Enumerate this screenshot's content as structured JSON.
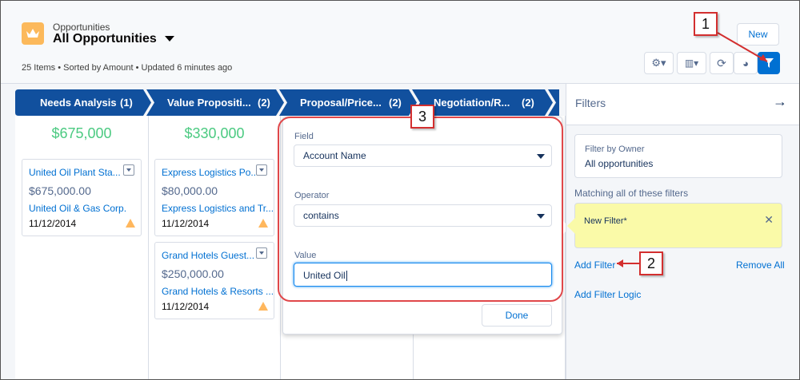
{
  "header": {
    "object_label": "Opportunities",
    "list_view": "All Opportunities",
    "meta": "25 Items • Sorted by Amount • Updated 6 minutes ago",
    "new_label": "New"
  },
  "stages": [
    {
      "name": "Needs Analysis",
      "count": "(1)"
    },
    {
      "name": "Value Propositi...",
      "count": "(2)"
    },
    {
      "name": "Proposal/Price...",
      "count": "(2)"
    },
    {
      "name": "Negotiation/R...",
      "count": "(2)"
    }
  ],
  "columns": [
    {
      "total": "$675,000",
      "cards": [
        {
          "name": "United Oil Plant Sta...",
          "amount": "$675,000.00",
          "account": "United Oil & Gas Corp.",
          "date": "11/12/2014"
        }
      ]
    },
    {
      "total": "$330,000",
      "cards": [
        {
          "name": "Express Logistics Po...",
          "amount": "$80,000.00",
          "account": "Express Logistics and Tr...",
          "date": "11/12/2014"
        },
        {
          "name": "Grand Hotels Guest...",
          "amount": "$250,000.00",
          "account": "Grand Hotels & Resorts ...",
          "date": "11/12/2014"
        }
      ]
    }
  ],
  "popover": {
    "field_label": "Field",
    "field_value": "Account Name",
    "operator_label": "Operator",
    "operator_value": "contains",
    "value_label": "Value",
    "value_value": "United Oil",
    "done_label": "Done"
  },
  "panel": {
    "title": "Filters",
    "owner_label": "Filter by Owner",
    "owner_value": "All opportunities",
    "matching": "Matching all of these filters",
    "new_filter": "New Filter*",
    "add_filter": "Add Filter",
    "remove_all": "Remove All",
    "add_logic": "Add Filter Logic"
  },
  "callouts": [
    "1",
    "2",
    "3"
  ],
  "colors": {
    "stage": "#11509e",
    "accent": "#0070d2",
    "total": "#4bca81",
    "filter_bg": "#fafaa8",
    "callout": "#d32f2f"
  }
}
